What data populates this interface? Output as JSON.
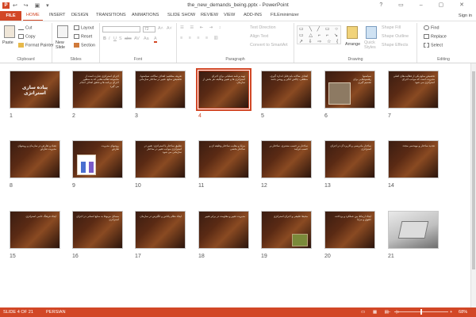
{
  "app": {
    "title": "the_new_demands_being.pptx - PowerPoint",
    "icon_label": "P",
    "qat": "↩ ↪ ▣ ▾",
    "window_controls": "? ▭ – ▢ ✕",
    "signin": "Sign in"
  },
  "tabs": [
    {
      "label": "FILE"
    },
    {
      "label": "HOME"
    },
    {
      "label": "INSERT"
    },
    {
      "label": "DESIGN"
    },
    {
      "label": "TRANSITIONS"
    },
    {
      "label": "ANIMATIONS"
    },
    {
      "label": "SLIDE SHOW"
    },
    {
      "label": "REVIEW"
    },
    {
      "label": "VIEW"
    },
    {
      "label": "ADD-INS"
    },
    {
      "label": "FILEminimizer"
    }
  ],
  "active_tab": "HOME",
  "ribbon": {
    "clipboard": {
      "label": "Clipboard",
      "paste": "Paste",
      "cut": "Cut",
      "copy": "Copy",
      "format_painter": "Format Painter"
    },
    "slides": {
      "label": "Slides",
      "new_slide": "New Slide",
      "layout": "Layout",
      "reset": "Reset",
      "section": "Section"
    },
    "font": {
      "label": "Font",
      "size": "72",
      "bold": "B",
      "italic": "I",
      "underline": "U",
      "shadow": "S",
      "strike": "abc",
      "spacing": "AV",
      "case": "Aa",
      "color": "A"
    },
    "paragraph": {
      "label": "Paragraph",
      "text_direction": "Text Direction",
      "align_text": "Align Text",
      "smartart": "Convert to SmartArt"
    },
    "drawing": {
      "label": "Drawing",
      "shapes_glyphs": "▭ ╲ ╱ ▭ ○ ▭ △ ⌐ ⌐ ↘ ↗ ⇩ ⇨ ☆ { } ★ ⌒ ▾",
      "arrange": "Arrange",
      "quick_styles": "Quick Styles",
      "shape_fill": "Shape Fill",
      "shape_outline": "Shape Outline",
      "shape_effects": "Shape Effects"
    },
    "editing": {
      "label": "Editing",
      "find": "Find",
      "replace": "Replace",
      "select": "Select"
    }
  },
  "slides": [
    {
      "num": "1",
      "title": "پیاده سازی استراتژی",
      "text": ""
    },
    {
      "num": "2",
      "title": "",
      "text": "اجرای استراتژی عبارت است از مجموعه فعالیت‌هایی که به منظور اجرای برنامه ها و تحقق اهداف انجام می گیرد"
    },
    {
      "num": "3",
      "title": "",
      "text": "تعریف مفاهیم: اهداف سالانه، سیاستها، تخصیص منابع، تغییر در ساختار سازمانی"
    },
    {
      "num": "4",
      "title": "",
      "text": "تهیه برنامه عملیاتی برای اجرای استراتژی ها و تعیین وظایف هر بخش از سازمان"
    },
    {
      "num": "5",
      "title": "",
      "text": "اهداف سالانه باید قابل اندازه گیری، منطقی، چالش انگیز و روشن باشد"
    },
    {
      "num": "6",
      "title": "",
      "text": "سیاستها رهنمودهایی برای تصمیم گیری"
    },
    {
      "num": "7",
      "title": "",
      "text": "تخصیص منابع یکی از فعالیت‌های اصلی مدیریت است که موجب اجرای استراتژی می شود"
    },
    {
      "num": "8",
      "title": "",
      "text": "تضاد و تعارض در سازمان و روشهای مدیریت تعارض"
    },
    {
      "num": "9",
      "title": "",
      "text": "روشهای مدیریت تعارض"
    },
    {
      "num": "10",
      "title": "",
      "text": "تطبیق ساختار با استراتژی: تغییر در استراتژی موجب تغییر در ساختار سازمانی می شود"
    },
    {
      "num": "11",
      "title": "",
      "text": "مزایا و معایب ساختار وظیفه ای و ساختار بخشی"
    },
    {
      "num": "12",
      "title": "",
      "text": "ساختار بر حسب مشتری، ساختار بر حسب فرآیند"
    },
    {
      "num": "13",
      "title": "",
      "text": "ساختار ماتریسی و کاربرد آن در اجرای استراتژی"
    },
    {
      "num": "14",
      "title": "",
      "text": "تجدید ساختار و مهندسی مجدد"
    },
    {
      "num": "15",
      "title": "",
      "text": "ایجاد فرهنگ حامی استراتژی"
    },
    {
      "num": "16",
      "title": "",
      "text": "مسائل مربوط به منابع انسانی در اجرای استراتژی"
    },
    {
      "num": "17",
      "title": "",
      "text": "ایجاد نظام پاداش و انگیزش در سازمان"
    },
    {
      "num": "18",
      "title": "",
      "text": "مدیریت تغییر و مقاومت در برابر تغییر"
    },
    {
      "num": "19",
      "title": "",
      "text": "محیط طبیعی و اجرای استراتژی"
    },
    {
      "num": "20",
      "title": "",
      "text": "ایجاد ارتباط بین عملکرد و پرداخت حقوق و مزایا"
    },
    {
      "num": "21",
      "title": "",
      "text": ""
    }
  ],
  "status": {
    "slide": "SLIDE 4 OF 21",
    "language": "PERSIAN",
    "zoom": "68%"
  },
  "colors": {
    "accent": "#d24726",
    "slide_bg": "#5a2a14",
    "selection": "#d24726"
  }
}
